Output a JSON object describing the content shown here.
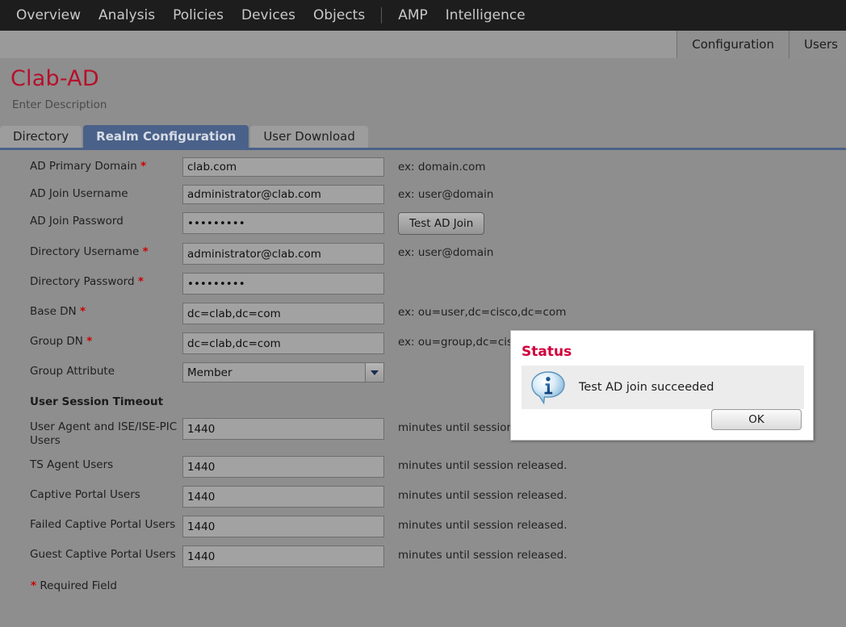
{
  "topnav": {
    "items": [
      {
        "label": "Overview"
      },
      {
        "label": "Analysis"
      },
      {
        "label": "Policies"
      },
      {
        "label": "Devices"
      },
      {
        "label": "Objects"
      },
      {
        "label": "AMP"
      },
      {
        "label": "Intelligence"
      }
    ]
  },
  "subnav": {
    "tabs": [
      {
        "label": "Configuration"
      },
      {
        "label": "Users"
      }
    ]
  },
  "header": {
    "title": "Clab-AD",
    "description": "Enter Description",
    "title_color": "#b5112b"
  },
  "tabs": [
    {
      "label": "Directory",
      "active": false
    },
    {
      "label": "Realm Configuration",
      "active": true
    },
    {
      "label": "User Download",
      "active": false
    }
  ],
  "accent_color": "#4a6189",
  "form": {
    "fields": [
      {
        "label": "AD Primary Domain",
        "required": true,
        "type": "text",
        "value": "clab.com",
        "hint": "ex: domain.com"
      },
      {
        "label": "AD Join Username",
        "required": false,
        "type": "text",
        "value": "administrator@clab.com",
        "hint": "ex: user@domain"
      },
      {
        "label": "AD Join Password",
        "required": false,
        "type": "password",
        "value": "•••••••••",
        "hint": "",
        "button": "Test AD Join"
      },
      {
        "label": "Directory Username",
        "required": true,
        "type": "text",
        "value": "administrator@clab.com",
        "hint": "ex: user@domain"
      },
      {
        "label": "Directory Password",
        "required": true,
        "type": "password",
        "value": "•••••••••",
        "hint": ""
      },
      {
        "label": "Base DN",
        "required": true,
        "type": "text",
        "value": "dc=clab,dc=com",
        "hint": "ex: ou=user,dc=cisco,dc=com"
      },
      {
        "label": "Group DN",
        "required": true,
        "type": "text",
        "value": "dc=clab,dc=com",
        "hint": "ex: ou=group,dc=cisco,dc=com"
      },
      {
        "label": "Group Attribute",
        "required": false,
        "type": "select",
        "value": "Member",
        "hint": ""
      }
    ],
    "session_section_title": "User Session Timeout",
    "session_fields": [
      {
        "label": "User Agent and ISE/ISE-PIC Users",
        "value": "1440",
        "hint": "minutes until session released."
      },
      {
        "label": "TS Agent Users",
        "value": "1440",
        "hint": "minutes until session released."
      },
      {
        "label": "Captive Portal Users",
        "value": "1440",
        "hint": "minutes until session released."
      },
      {
        "label": "Failed Captive Portal Users",
        "value": "1440",
        "hint": "minutes until session released."
      },
      {
        "label": "Guest Captive Portal Users",
        "value": "1440",
        "hint": "minutes until session released."
      }
    ],
    "required_note": "Required Field",
    "required_marker": "*"
  },
  "dialog": {
    "title": "Status",
    "message": "Test AD join succeeded",
    "ok_label": "OK",
    "icon": "info-icon",
    "title_color": "#d1003c"
  }
}
